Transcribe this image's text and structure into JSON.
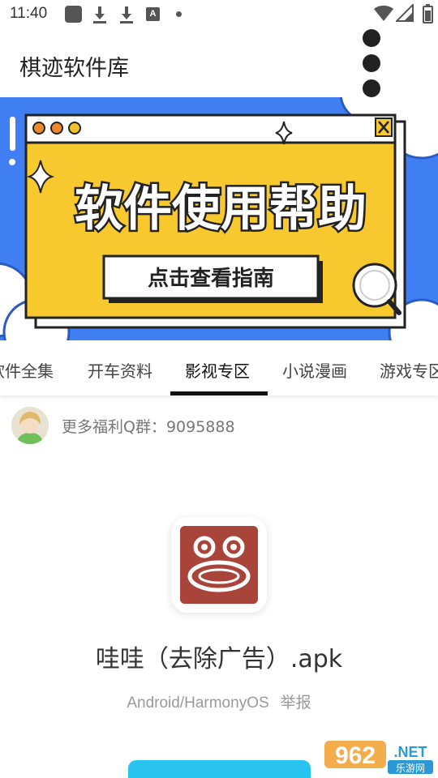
{
  "status_bar": {
    "time": "11:40",
    "icons": [
      "app-notification-icon",
      "download-icon",
      "download-icon",
      "a-text-icon",
      "dot-icon",
      "wifi-icon",
      "signal-icon",
      "battery-icon"
    ]
  },
  "app_bar": {
    "title": "棋迹软件库",
    "menu_icon": "overflow-menu-icon"
  },
  "banner": {
    "headline": "软件使用帮助",
    "button_text": "点击查看指南",
    "colors": {
      "background": "#3f7ff2",
      "panel": "#f7c92f",
      "dots": [
        "#f0892e",
        "#f0892e",
        "#f0c22e"
      ]
    }
  },
  "tabs": {
    "items": [
      "软件全集",
      "开车资料",
      "影视专区",
      "小说漫画",
      "游戏专区"
    ],
    "selected_index": 2
  },
  "group_info": {
    "text": "更多福利Q群：9095888"
  },
  "app": {
    "name": "哇哇（去除广告）.apk",
    "platform": "Android/HarmonyOS",
    "report_label": "举报",
    "icon_color": "#a8443a"
  },
  "watermark": {
    "brand": "962",
    "suffix": ".NET",
    "subtitle": "乐游网"
  },
  "colors": {
    "accent": "#29c3f0",
    "tab_indicator": "#111111"
  }
}
